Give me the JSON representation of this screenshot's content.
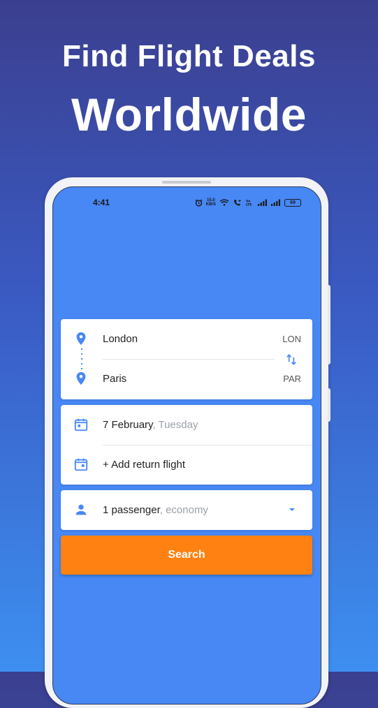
{
  "headline": {
    "line1": "Find Flight Deals",
    "line2": "Worldwide"
  },
  "status_bar": {
    "time": "4:41",
    "net_speed_value": "15.0",
    "net_speed_unit": "KB/S",
    "battery": "69"
  },
  "route": {
    "origin": {
      "city": "London",
      "code": "LON"
    },
    "destination": {
      "city": "Paris",
      "code": "PAR"
    }
  },
  "dates": {
    "departure_date": "7 February",
    "departure_day": ", Tuesday",
    "return_label": "+ Add return flight"
  },
  "passengers": {
    "count_label": "1 passenger",
    "class_label": ", economy"
  },
  "search_label": "Search",
  "colors": {
    "accent": "#4788f5",
    "button": "#ff8111"
  },
  "icons": [
    "location-pin-icon",
    "swap-icon",
    "calendar-icon",
    "person-icon",
    "dropdown-arrow-icon",
    "alarm-icon",
    "wifi-icon",
    "call-icon",
    "signal-icon",
    "battery-icon"
  ]
}
